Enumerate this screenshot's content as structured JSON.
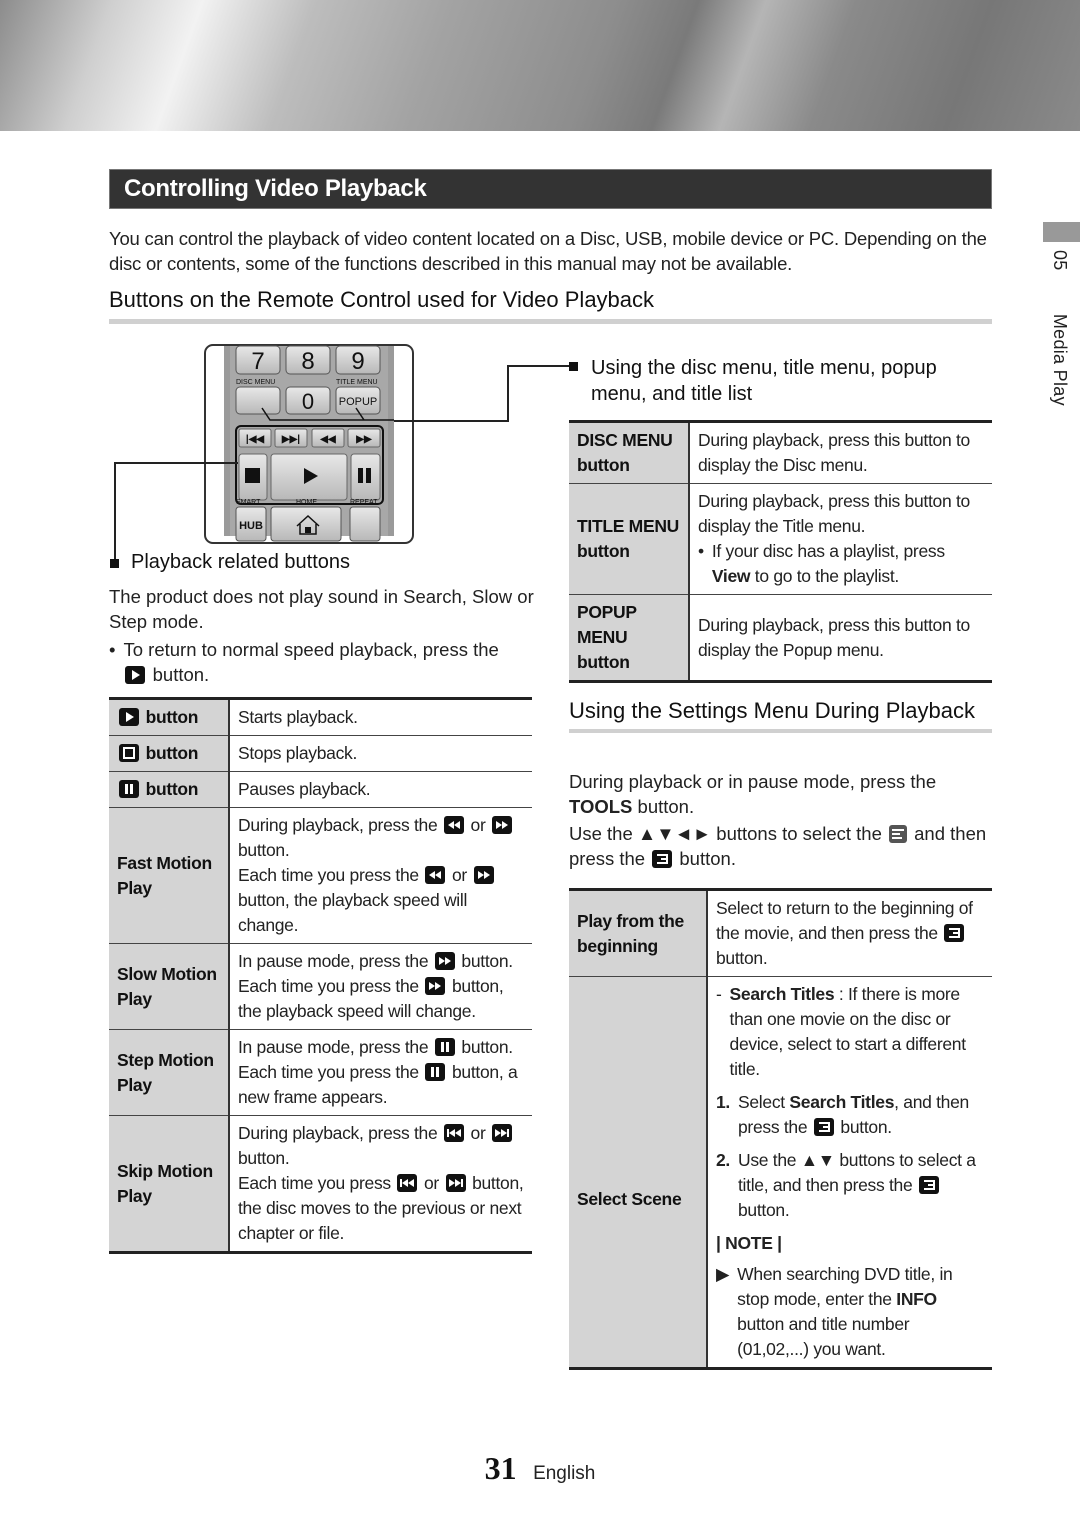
{
  "page_title": "Controlling Video Playback",
  "intro": "You can control the playback of video content located on a Disc, USB, mobile device or PC. Depending on the disc or contents, some of the functions described in this manual may not be available.",
  "section_heading": "Buttons on the Remote Control used for Video Playback",
  "side_tab": {
    "number": "05",
    "label": "Media Play"
  },
  "remote": {
    "keys": [
      "7",
      "8",
      "9",
      "0"
    ],
    "labels": {
      "disc_menu": "DISC MENU",
      "title_menu": "TITLE MENU",
      "popup": "POPUP",
      "smart": "SMART",
      "hub": "HUB",
      "home": "HOME",
      "repeat": "REPEAT"
    }
  },
  "playback_section": {
    "heading": "Playback related buttons",
    "note": "The product does not play sound in Search, Slow or Step mode.",
    "bullet_pre": "To return to normal speed playback, press the",
    "bullet_post": "button.",
    "rows": [
      {
        "key": "button",
        "icon": "play-icon",
        "value": "Starts playback."
      },
      {
        "key": "button",
        "icon": "stop-icon",
        "value": "Stops playback."
      },
      {
        "key": "button",
        "icon": "pause-icon",
        "value": "Pauses playback."
      },
      {
        "key": "Fast Motion Play",
        "lines": [
          "During playback, press the",
          "or",
          "button.",
          "Each time you press the",
          "or",
          "button, the playback speed will change."
        ]
      },
      {
        "key": "Slow Motion Play",
        "lines": [
          "In pause mode, press the",
          "button.",
          "Each time you press the",
          "button, the playback speed will change."
        ]
      },
      {
        "key": "Step Motion Play",
        "lines": [
          "In pause mode, press the",
          "button.",
          "Each time you press the",
          "button, a new frame appears."
        ]
      },
      {
        "key": "Skip Motion Play",
        "lines": [
          "During playback, press the",
          "or",
          "button.",
          "Each time you press",
          "or",
          "button, the disc moves to the previous or next chapter or file."
        ]
      }
    ]
  },
  "menu_section": {
    "heading": "Using the disc menu, title menu, popup menu, and title list",
    "rows": [
      {
        "key": "DISC MENU button",
        "value": "During playback, press this button to display the Disc menu."
      },
      {
        "key": "TITLE MENU button",
        "value": "During playback, press this button to display the Title menu.",
        "bullet_pre": "If your disc has a playlist, press",
        "bullet_bold": "View",
        "bullet_post": "to go to the playlist."
      },
      {
        "key": "POPUP MENU button",
        "value": "During playback, press this button to display the Popup menu."
      }
    ]
  },
  "settings_section": {
    "heading": "Using the Settings Menu During Playback",
    "p1_pre": "During playback or in pause mode, press the",
    "p1_bold": "TOOLS",
    "p1_post": "button.",
    "p2_pre": "Use the ▲▼◄► buttons to select the",
    "p2_mid": "and then press the",
    "p2_post": "button.",
    "rows": [
      {
        "key": "Play from the beginning",
        "value_pre": "Select to return to the beginning of the movie, and then press the",
        "value_post": "button."
      },
      {
        "key": "Select Scene",
        "dash_bold": "Search Titles",
        "dash_text": ": If there is more than one movie on the disc or device, select to start a different title.",
        "step1_num": "1.",
        "step1_pre": "Select",
        "step1_bold": "Search Titles",
        "step1_mid": ", and then press the",
        "step1_post": "button.",
        "step2_num": "2.",
        "step2_pre": "Use the ▲▼ buttons to select a title, and then press the",
        "step2_post": "button.",
        "note_label": "| NOTE |",
        "note_pre": "When searching DVD title, in stop mode, enter the",
        "note_bold": "INFO",
        "note_post": "button and title number (01,02,...) you want."
      }
    ]
  },
  "footer": {
    "page_number": "31",
    "language": "English"
  }
}
